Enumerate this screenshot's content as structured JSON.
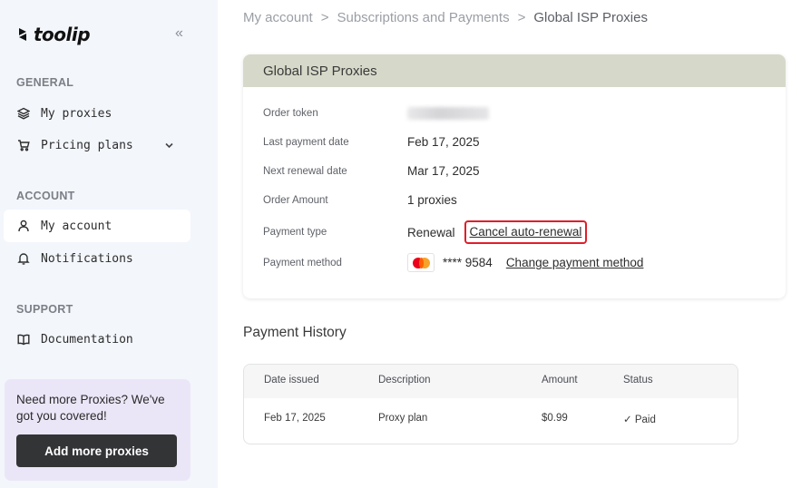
{
  "sidebar": {
    "logo_text": "toolip",
    "collapse_icon": "«",
    "sections": {
      "general": "GENERAL",
      "account": "ACCOUNT",
      "support": "SUPPORT"
    },
    "items": {
      "my_proxies": "My proxies",
      "pricing_plans": "Pricing plans",
      "my_account": "My account",
      "notifications": "Notifications",
      "documentation": "Documentation"
    },
    "promo": {
      "text": "Need more Proxies? We've got you covered!",
      "button": "Add more proxies"
    }
  },
  "breadcrumb": {
    "item1": "My account",
    "item2": "Subscriptions and Payments",
    "item3": "Global ISP Proxies",
    "separator": ">"
  },
  "order": {
    "title": "Global ISP Proxies",
    "labels": {
      "token": "Order token",
      "last_payment": "Last payment date",
      "next_renewal": "Next renewal date",
      "amount": "Order Amount",
      "payment_type": "Payment type",
      "payment_method": "Payment method"
    },
    "values": {
      "last_payment": "Feb 17, 2025",
      "next_renewal": "Mar 17, 2025",
      "amount": "1 proxies",
      "payment_type": "Renewal",
      "cancel_link": "Cancel auto-renewal",
      "card_number": "**** 9584",
      "change_method_link": "Change payment method"
    }
  },
  "history": {
    "title": "Payment History",
    "columns": [
      "Date issued",
      "Description",
      "Amount",
      "Status"
    ],
    "rows": [
      {
        "date": "Feb 17, 2025",
        "description": "Proxy plan",
        "amount": "$0.99",
        "status": "Paid",
        "status_icon": "✓"
      }
    ]
  },
  "colors": {
    "card_header": "#d6d9c9",
    "sidebar_bg": "#f3f6fb",
    "highlight_border": "#e01e2b",
    "promo_bg": "#ebe6f7",
    "promo_button": "#333436"
  }
}
